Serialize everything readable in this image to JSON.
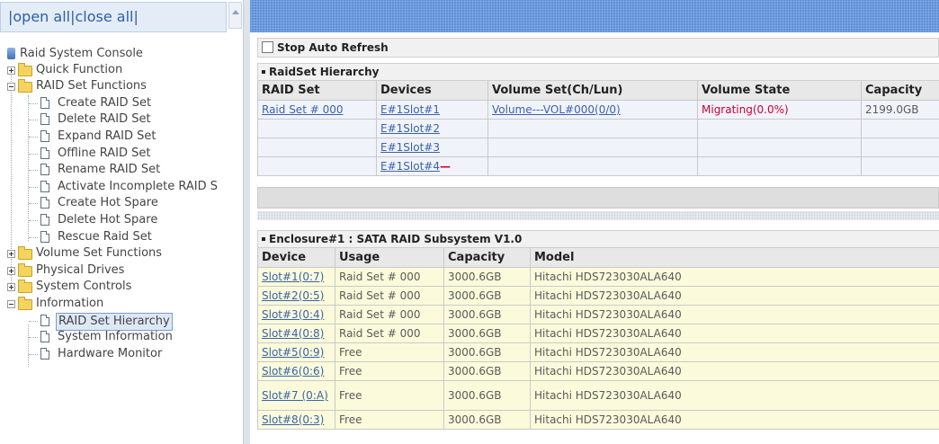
{
  "left": {
    "open_close": "|open all|close all|",
    "tree": [
      {
        "label": "Raid System Console",
        "kind": "root"
      },
      {
        "label": "Quick Function",
        "kind": "folder",
        "state": "collapsed"
      },
      {
        "label": "RAID Set Functions",
        "kind": "folder",
        "state": "expanded"
      },
      {
        "label": "Create RAID Set",
        "kind": "doc"
      },
      {
        "label": "Delete RAID Set",
        "kind": "doc"
      },
      {
        "label": "Expand RAID Set",
        "kind": "doc"
      },
      {
        "label": "Offline RAID Set",
        "kind": "doc"
      },
      {
        "label": "Rename RAID Set",
        "kind": "doc"
      },
      {
        "label": "Activate Incomplete RAID S",
        "kind": "doc"
      },
      {
        "label": "Create Hot Spare",
        "kind": "doc"
      },
      {
        "label": "Delete Hot Spare",
        "kind": "doc"
      },
      {
        "label": "Rescue Raid Set",
        "kind": "doc"
      },
      {
        "label": "Volume Set Functions",
        "kind": "folder",
        "state": "collapsed"
      },
      {
        "label": "Physical Drives",
        "kind": "folder",
        "state": "collapsed"
      },
      {
        "label": "System Controls",
        "kind": "folder",
        "state": "collapsed"
      },
      {
        "label": "Information",
        "kind": "folder",
        "state": "expanded"
      },
      {
        "label": "RAID Set Hierarchy",
        "kind": "doc",
        "selected": true
      },
      {
        "label": "System Information",
        "kind": "doc"
      },
      {
        "label": "Hardware Monitor",
        "kind": "doc"
      }
    ]
  },
  "main": {
    "stop_auto_refresh": "Stop Auto Refresh",
    "raidset": {
      "title": "RaidSet Hierarchy",
      "headers": [
        "RAID Set",
        "Devices",
        "Volume Set(Ch/Lun)",
        "Volume State",
        "Capacity"
      ],
      "rows": [
        {
          "raid_set": "Raid Set # 000",
          "device": "E#1Slot#1",
          "volume": "Volume---VOL#000(0/0)",
          "state": "Migrating(0.0%)",
          "capacity": "2199.0GB"
        },
        {
          "raid_set": "",
          "device": "E#1Slot#2",
          "volume": "",
          "state": "",
          "capacity": ""
        },
        {
          "raid_set": "",
          "device": "E#1Slot#3",
          "volume": "",
          "state": "",
          "capacity": ""
        },
        {
          "raid_set": "",
          "device": "E#1Slot#4",
          "volume": "",
          "state": "",
          "capacity": ""
        }
      ]
    },
    "enclosure": {
      "title": "Enclosure#1 : SATA RAID Subsystem V1.0",
      "headers": [
        "Device",
        "Usage",
        "Capacity",
        "Model"
      ],
      "rows": [
        {
          "device": "Slot#1(0:7)",
          "usage": "Raid Set # 000",
          "capacity": "3000.6GB",
          "model": "Hitachi HDS723030ALA640"
        },
        {
          "device": "Slot#2(0:5)",
          "usage": "Raid Set # 000",
          "capacity": "3000.6GB",
          "model": "Hitachi HDS723030ALA640"
        },
        {
          "device": "Slot#3(0:4)",
          "usage": "Raid Set # 000",
          "capacity": "3000.6GB",
          "model": "Hitachi HDS723030ALA640"
        },
        {
          "device": "Slot#4(0:8)",
          "usage": "Raid Set # 000",
          "capacity": "3000.6GB",
          "model": "Hitachi HDS723030ALA640"
        },
        {
          "device": "Slot#5(0:9)",
          "usage": "Free",
          "capacity": "3000.6GB",
          "model": "Hitachi HDS723030ALA640"
        },
        {
          "device": "Slot#6(0:6)",
          "usage": "Free",
          "capacity": "3000.6GB",
          "model": "Hitachi HDS723030ALA640"
        },
        {
          "device": "Slot#7 (0:A)",
          "usage": "Free",
          "capacity": "3000.6GB",
          "model": "Hitachi HDS723030ALA640"
        },
        {
          "device": "Slot#8(0:3)",
          "usage": "Free",
          "capacity": "3000.6GB",
          "model": "Hitachi HDS723030ALA640"
        }
      ]
    }
  }
}
